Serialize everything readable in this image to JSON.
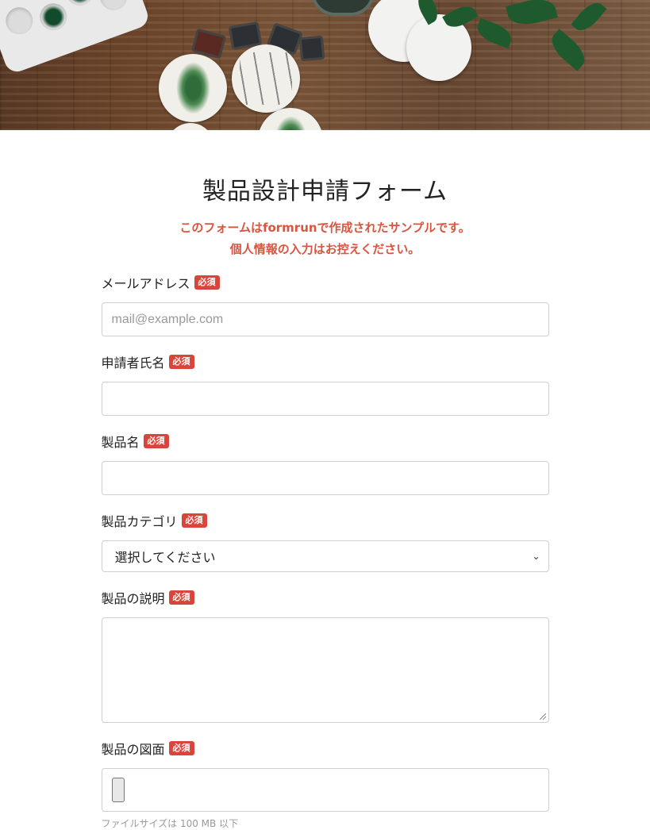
{
  "form": {
    "title": "製品設計申請フォーム",
    "notice_line1": "このフォームはformrunで作成されたサンプルです。",
    "notice_line2": "個人情報の入力はお控えください。",
    "required_badge": "必須",
    "fields": {
      "email": {
        "label": "メールアドレス",
        "placeholder": "mail@example.com",
        "value": ""
      },
      "applicant_name": {
        "label": "申請者氏名",
        "value": ""
      },
      "product_name": {
        "label": "製品名",
        "value": ""
      },
      "product_category": {
        "label": "製品カテゴリ",
        "selected": "選択してください"
      },
      "product_description": {
        "label": "製品の説明",
        "value": ""
      },
      "product_drawing": {
        "label": "製品の図面",
        "hint": "ファイルサイズは 100 MB 以下"
      }
    }
  },
  "colors": {
    "notice_red": "#d9553f",
    "badge_red": "#d9453a",
    "border": "#cfcfcf"
  }
}
